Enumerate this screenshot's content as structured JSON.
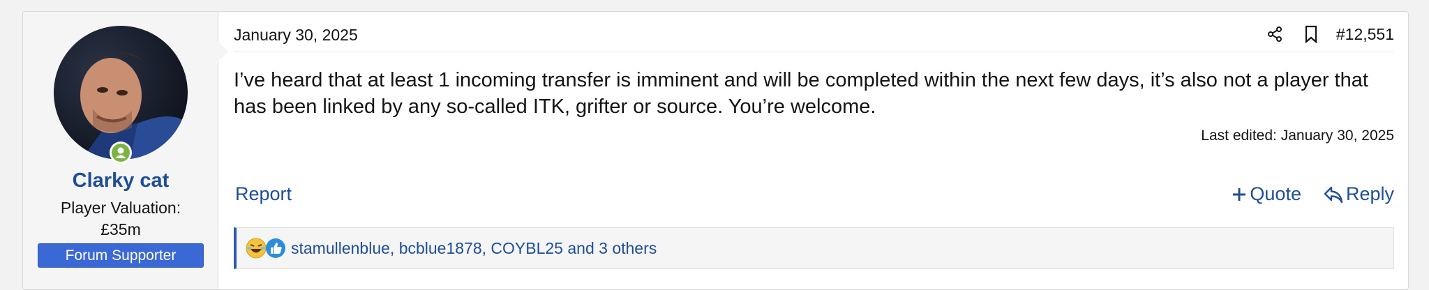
{
  "user": {
    "name": "Clarky cat",
    "valuation_label": "Player Valuation:",
    "valuation_value": "£35m",
    "badge": "Forum Supporter",
    "status_color": "#7cb342"
  },
  "post": {
    "date": "January 30, 2025",
    "number": "#12,551",
    "message": "I’ve heard that at least 1 incoming transfer is imminent and will be completed within the next few days, it’s also not a player that has been linked by any so-called ITK, grifter or source. You’re welcome.",
    "last_edited": "Last edited: January 30, 2025"
  },
  "actions": {
    "report": "Report",
    "quote": "Quote",
    "reply": "Reply"
  },
  "reactions": {
    "icons": [
      "laughing-emoji-icon",
      "thumbs-up-icon"
    ],
    "text": "stamullenblue, bcblue1878, COYBL25 and 3 others"
  },
  "colors": {
    "link": "#1f4e97",
    "badge": "#3a68d4",
    "accent_bar": "#2f57b8"
  }
}
